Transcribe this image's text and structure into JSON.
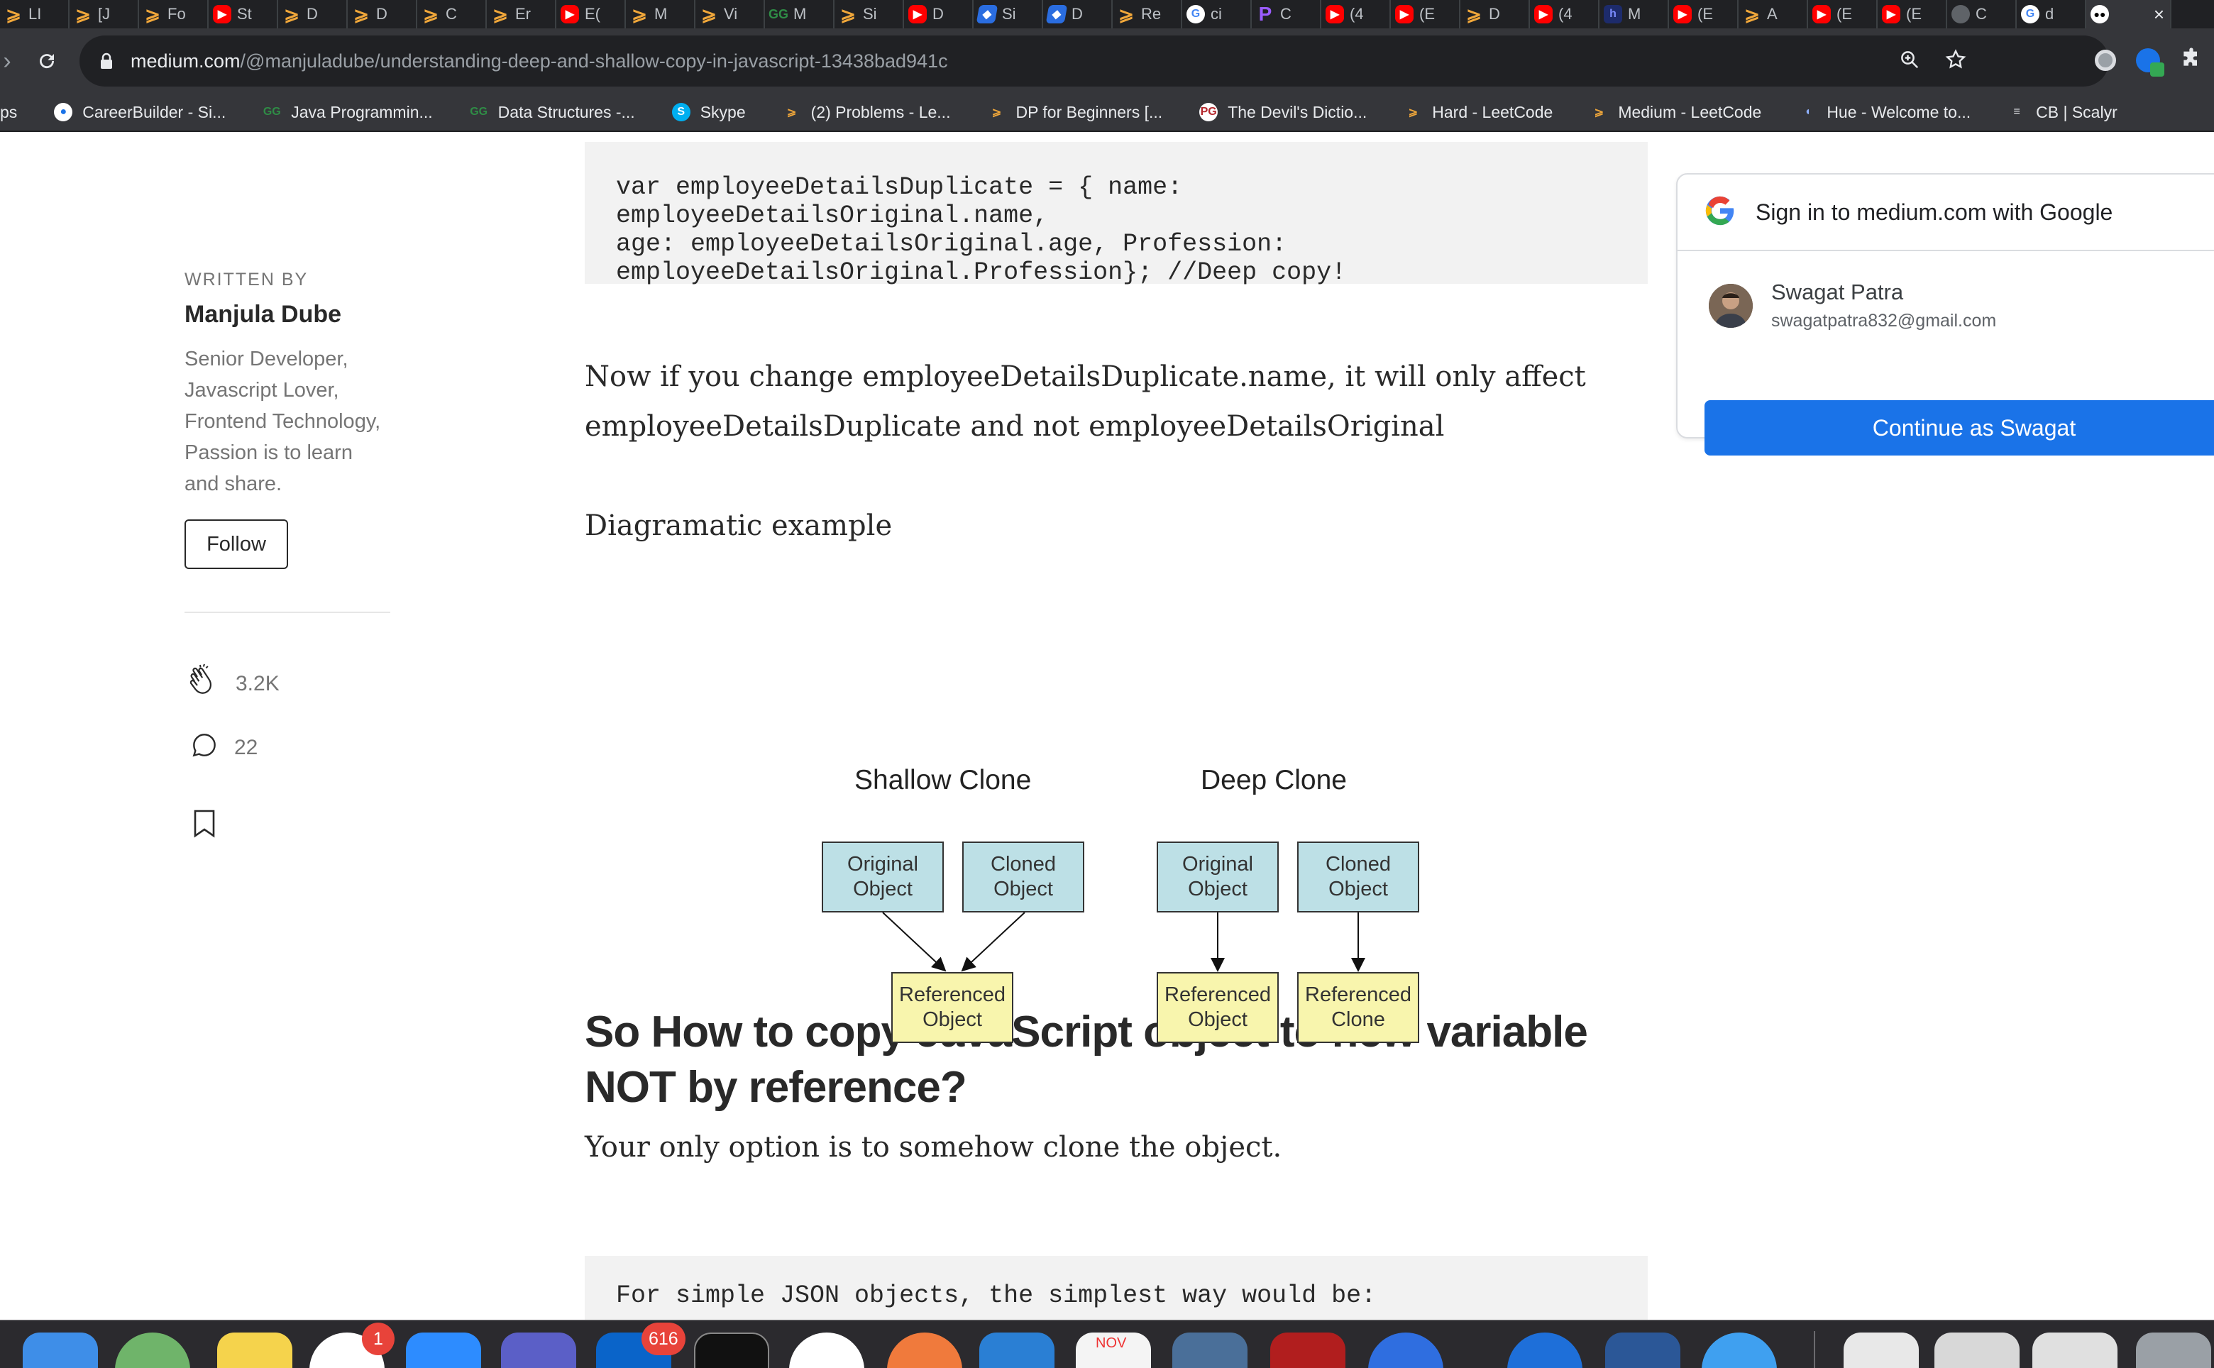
{
  "browser": {
    "tabs": [
      {
        "icon": "leetcode-icon",
        "label": "LI"
      },
      {
        "icon": "leetcode-icon",
        "label": "[J"
      },
      {
        "icon": "leetcode-icon",
        "label": "Fo"
      },
      {
        "icon": "youtube-icon",
        "label": "St"
      },
      {
        "icon": "leetcode-icon",
        "label": "D"
      },
      {
        "icon": "leetcode-icon",
        "label": "D"
      },
      {
        "icon": "leetcode-icon",
        "label": "C"
      },
      {
        "icon": "leetcode-icon",
        "label": "Er"
      },
      {
        "icon": "youtube-icon",
        "label": "E("
      },
      {
        "icon": "leetcode-icon",
        "label": "M"
      },
      {
        "icon": "leetcode-icon",
        "label": "Vi"
      },
      {
        "icon": "gfg-icon",
        "label": "M"
      },
      {
        "icon": "leetcode-icon",
        "label": "Si"
      },
      {
        "icon": "youtube-icon",
        "label": "D"
      },
      {
        "icon": "stackoverflow-icon",
        "label": "Si"
      },
      {
        "icon": "stackoverflow-icon",
        "label": "D"
      },
      {
        "icon": "leetcode-icon",
        "label": "Re"
      },
      {
        "icon": "google-icon",
        "label": "ci"
      },
      {
        "icon": "purple-icon",
        "label": "C"
      },
      {
        "icon": "youtube-icon",
        "label": "(4"
      },
      {
        "icon": "youtube-icon",
        "label": "(E"
      },
      {
        "icon": "leetcode-icon",
        "label": "D"
      },
      {
        "icon": "youtube-icon",
        "label": "(4"
      },
      {
        "icon": "hashnode-icon",
        "label": "M"
      },
      {
        "icon": "youtube-icon",
        "label": "(E"
      },
      {
        "icon": "leetcode-icon",
        "label": "A"
      },
      {
        "icon": "youtube-icon",
        "label": "(E"
      },
      {
        "icon": "youtube-icon",
        "label": "(E"
      },
      {
        "icon": "globe-icon",
        "label": "C"
      },
      {
        "icon": "google-icon",
        "label": "d"
      },
      {
        "icon": "medium-icon",
        "label": ""
      }
    ],
    "url_domain": "medium.com",
    "url_path": "/@manjuladube/understanding-deep-and-shallow-copy-in-javascript-13438bad941c",
    "bookmarks": [
      {
        "label": "ps",
        "icon": "apps-icon"
      },
      {
        "label": "CareerBuilder - Si...",
        "icon": "careerbuilder-icon"
      },
      {
        "label": "Java Programmin...",
        "icon": "gfg-icon"
      },
      {
        "label": "Data Structures -...",
        "icon": "gfg-icon"
      },
      {
        "label": "Skype",
        "icon": "skype-icon"
      },
      {
        "label": "(2) Problems - Le...",
        "icon": "leetcode-icon"
      },
      {
        "label": "DP for Beginners [...",
        "icon": "leetcode-icon"
      },
      {
        "label": "The Devil's Dictio...",
        "icon": "pg-icon"
      },
      {
        "label": "Hard - LeetCode",
        "icon": "leetcode-icon"
      },
      {
        "label": "Medium - LeetCode",
        "icon": "leetcode-icon"
      },
      {
        "label": "Hue - Welcome to...",
        "icon": "hue-icon"
      },
      {
        "label": "CB | Scalyr",
        "icon": "scalyr-icon"
      }
    ]
  },
  "sidebar": {
    "written_by": "WRITTEN BY",
    "author": "Manjula Dube",
    "bio": "Senior Developer, Javascript Lover, Frontend Technology, Passion is to learn and share.",
    "follow": "Follow",
    "claps": "3.2K",
    "responses": "22"
  },
  "article": {
    "code1": "var employeeDetailsDuplicate = { name: employeeDetailsOriginal.name,\nage: employeeDetailsOriginal.age, Profession:\nemployeeDetailsOriginal.Profession}; //Deep copy!",
    "para1": "Now if you change employeeDetailsDuplicate.name, it will only affect employeeDetailsDuplicate and not employeeDetailsOriginal",
    "para2": "Diagramatic example",
    "diagram": {
      "shallow_title": "Shallow Clone",
      "deep_title": "Deep Clone",
      "shallow_original": "Original\nObject",
      "shallow_cloned": "Cloned\nObject",
      "shallow_referenced": "Referenced\nObject",
      "deep_original": "Original\nObject",
      "deep_cloned": "Cloned\nObject",
      "deep_referenced": "Referenced\nObject",
      "deep_referenced_clone": "Referenced\nClone"
    },
    "heading": "So How to copy JavaScript object to new variable NOT by reference?",
    "para3": "Your only option is to somehow clone the object.",
    "code2": "For simple JSON objects, the simplest way would be:"
  },
  "google_signin": {
    "title": "Sign in to medium.com with Google",
    "name": "Swagat Patra",
    "email": "swagatpatra832@gmail.com",
    "button": "Continue as Swagat"
  },
  "dock": {
    "badges": {
      "slack": "1",
      "outlook": "616"
    },
    "calendar_month": "NOV"
  },
  "colors": {
    "chrome_dark": "#202124",
    "chrome_toolbar": "#35363a",
    "text": "#292929",
    "muted": "#757575",
    "google_blue": "#1a73e8",
    "diagram_blue": "#bde0e6",
    "diagram_yellow": "#f8f5ad"
  }
}
